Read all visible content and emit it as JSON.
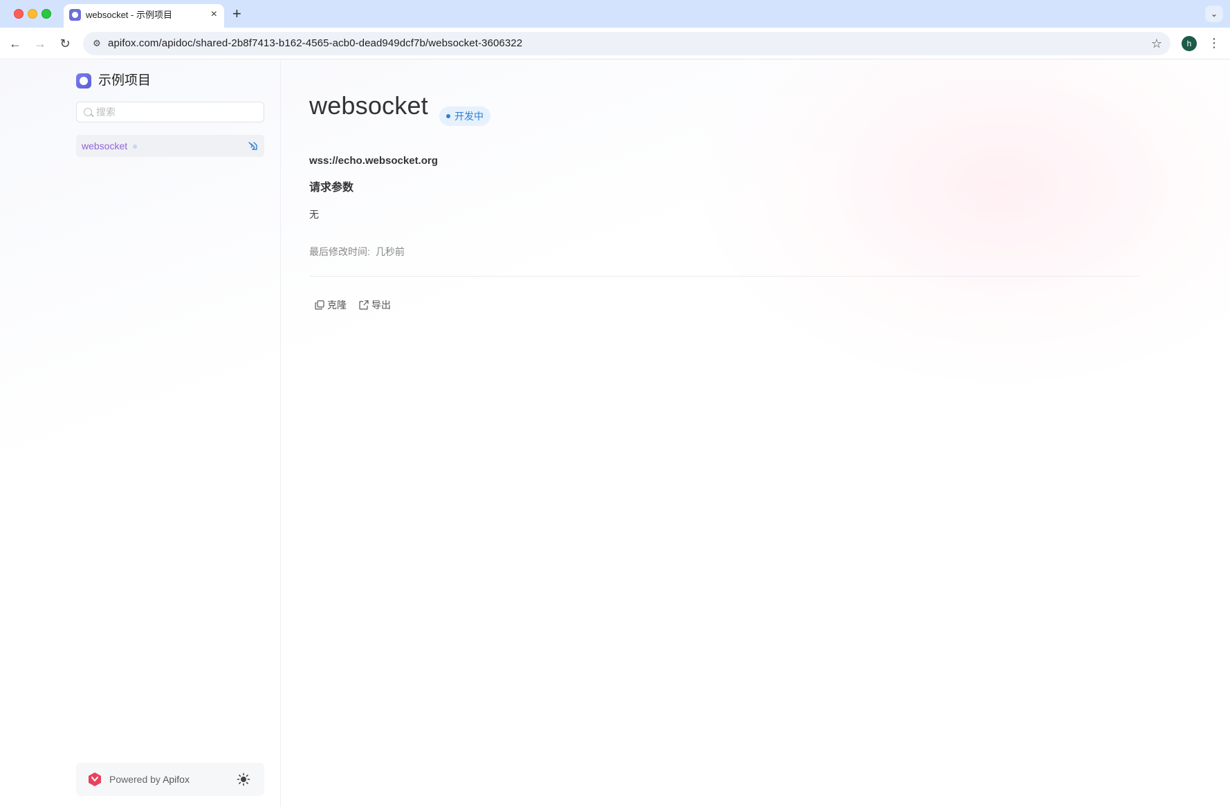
{
  "browser": {
    "tab_title": "websocket - 示例项目",
    "tab_close": "×",
    "new_tab": "+",
    "tab_search": "⌄",
    "url": "apifox.com/apidoc/shared-2b8f7413-b162-4565-acb0-dead949dcf7b/websocket-3606322",
    "profile_initial": "h",
    "back": "←",
    "forward": "→",
    "reload": "↻",
    "bookmark": "☆",
    "menu": "⋮",
    "site_info": "⚙"
  },
  "sidebar": {
    "project_name": "示例项目",
    "search_placeholder": "搜索",
    "search_value": "",
    "items": [
      {
        "label": "websocket",
        "icon": "websocket-icon",
        "selected": true
      }
    ],
    "footer": {
      "powered_prefix": "Powered by",
      "powered_brand": "Apifox",
      "theme_icon": "sun-icon"
    }
  },
  "main": {
    "title": "websocket",
    "status": "开发中",
    "endpoint": "wss://echo.websocket.org",
    "params_heading": "请求参数",
    "params_value": "无",
    "modified_label": "最后修改时间:",
    "modified_value": "几秒前",
    "actions": {
      "clone": "克隆",
      "export": "导出"
    }
  },
  "colors": {
    "accent_purple": "#8a67d4",
    "status_blue": "#2b7fd6",
    "status_bg": "#e6f1fc",
    "brand_red": "#e8425f"
  }
}
